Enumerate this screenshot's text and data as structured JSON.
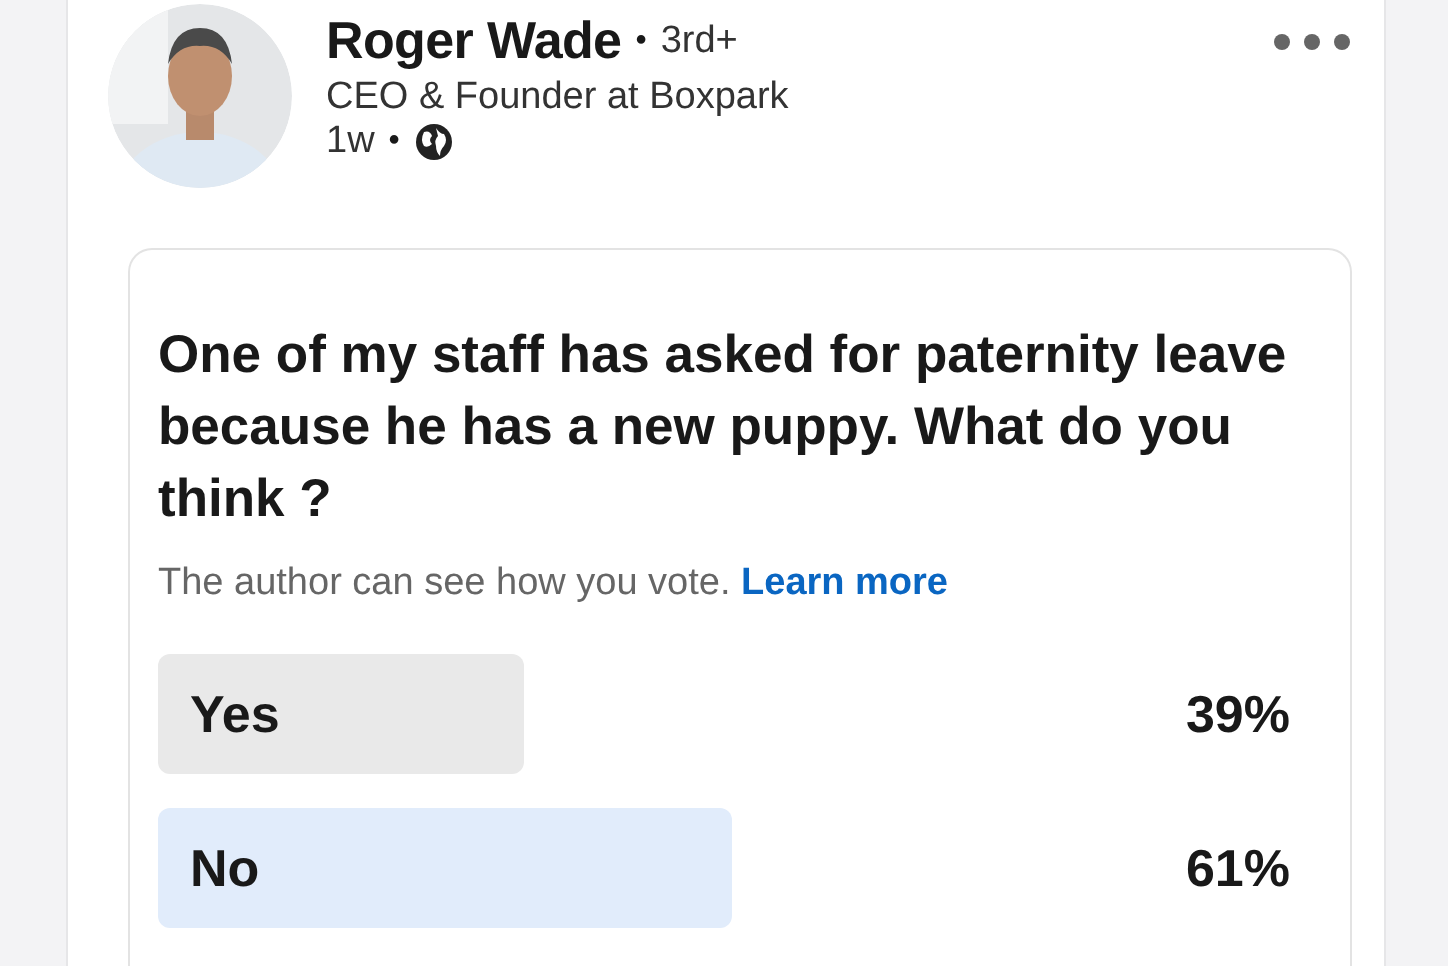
{
  "author": {
    "name": "Roger Wade",
    "separator": "•",
    "degree": "3rd+",
    "time_separator": "•",
    "headline": "CEO & Founder at Boxpark",
    "time": "1w"
  },
  "poll": {
    "question": "One of my staff has asked for paternity leave because he has a new puppy. What do you think ?",
    "notice": "The author can see how you vote.",
    "link": "Learn more",
    "options": [
      {
        "label": "Yes",
        "percent": "39%",
        "level": 0.39,
        "selected": false
      },
      {
        "label": "No",
        "percent": "61%",
        "level": 0.61,
        "selected": true
      }
    ]
  }
}
